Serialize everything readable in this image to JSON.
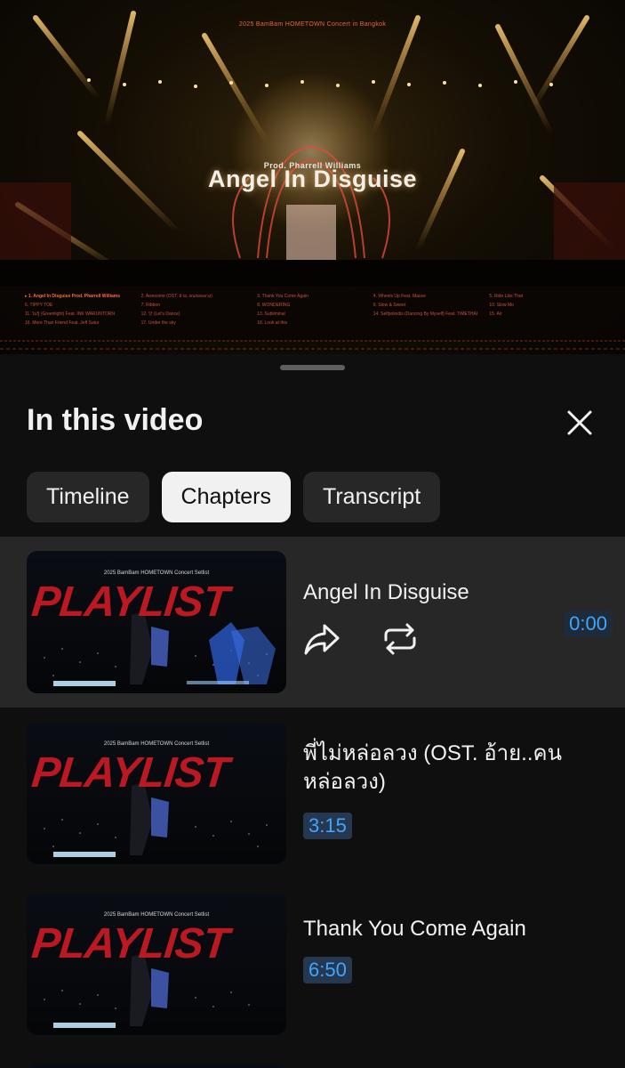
{
  "video": {
    "top_caption": "2025 BamBam HOMETOWN Concert in Bangkok",
    "subtitle": "Prod. Pharrell Williams",
    "title": "Angel In Disguise",
    "setlist": [
      {
        "text": "▸ 1. Angel In Disguise Prod. Pharrell Williams",
        "active": true
      },
      {
        "text": "2. Awesome (OST. อ้าย..คนหล่อลวง)",
        "active": false
      },
      {
        "text": "3. Thank You Come Again",
        "active": false
      },
      {
        "text": "4. Wheels Up Feat. Mauve",
        "active": false
      },
      {
        "text": "5. Ride Like That",
        "active": false
      },
      {
        "text": "6. TIPPY TOE",
        "active": false
      },
      {
        "text": "7. Ribbon",
        "active": false
      },
      {
        "text": "8. WONDERING",
        "active": false
      },
      {
        "text": "9. Slow & Sweet",
        "active": false
      },
      {
        "text": "10. Slow Mo",
        "active": false
      },
      {
        "text": "11. ไม่รู้ (Greenlight) Feat. INK WARUNTORN",
        "active": false
      },
      {
        "text": "12. 앗 (Let's Dance)",
        "active": false
      },
      {
        "text": "13. Subliminal",
        "active": false
      },
      {
        "text": "14. Selfpoloidis (Dancing By Myself) Feat. TIMETHAI",
        "active": false
      },
      {
        "text": "15. Air",
        "active": false
      },
      {
        "text": "16. More Than Friend Feat. Jeff Satur",
        "active": false
      },
      {
        "text": "17. Under the sky",
        "active": false
      },
      {
        "text": "18. Look at this",
        "active": false
      }
    ]
  },
  "sheet": {
    "title": "In this video",
    "close_icon": "close-icon",
    "tabs": [
      {
        "label": "Timeline",
        "active": false
      },
      {
        "label": "Chapters",
        "active": true
      },
      {
        "label": "Transcript",
        "active": false
      }
    ]
  },
  "chapters": [
    {
      "thumb_caption": "2025 BamBam HOMETOWN Concert Setlist",
      "thumb_text": "PLAYLIST",
      "title": "Angel In Disguise",
      "time": "0:00",
      "current": true
    },
    {
      "thumb_caption": "2025 BamBam HOMETOWN Concert Setlist",
      "thumb_text": "PLAYLIST",
      "title": "พี่ไม่หล่อลวง (OST. อ้าย..คนหล่อลวง)",
      "time": "3:15",
      "current": false
    },
    {
      "thumb_caption": "2025 BamBam HOMETOWN Concert Setlist",
      "thumb_text": "PLAYLIST",
      "title": "Thank You Come Again",
      "time": "6:50",
      "current": false
    }
  ],
  "colors": {
    "background": "#0f0f0f",
    "selected_row": "#272727",
    "timestamp": "#3ea6ff",
    "playlist_red": "#c41a24"
  }
}
